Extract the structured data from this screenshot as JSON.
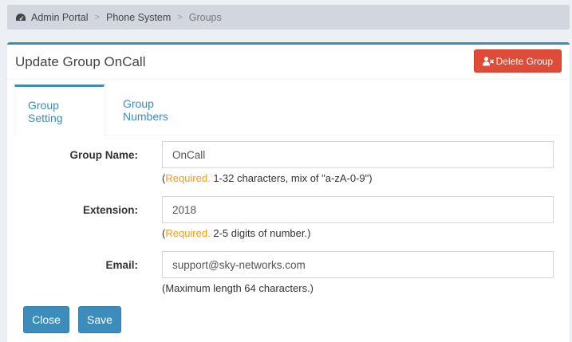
{
  "breadcrumb": {
    "items": [
      "Admin Portal",
      "Phone System",
      "Groups"
    ],
    "separator": ">"
  },
  "header": {
    "title": "Update Group OnCall",
    "delete_label": "Delete Group"
  },
  "tabs": [
    {
      "label": "Group Setting",
      "active": true
    },
    {
      "label": "Group Numbers",
      "active": false
    }
  ],
  "form": {
    "group_name": {
      "label": "Group Name:",
      "value": "OnCall",
      "help_open": "(",
      "help_required": "Required.",
      "help_text": " 1-32 characters, mix of \"a-zA-0-9\")"
    },
    "extension": {
      "label": "Extension:",
      "value": "2018",
      "help_open": "(",
      "help_required": "Required.",
      "help_text": " 2-5 digits of number.)"
    },
    "email": {
      "label": "Email:",
      "value": "support@sky-networks.com",
      "help_text": "(Maximum length 64 characters.)"
    }
  },
  "actions": {
    "close_label": "Close",
    "save_label": "Save"
  },
  "colors": {
    "primary": "#3c8dbc",
    "danger": "#dd4b39",
    "required": "#f39c12"
  }
}
